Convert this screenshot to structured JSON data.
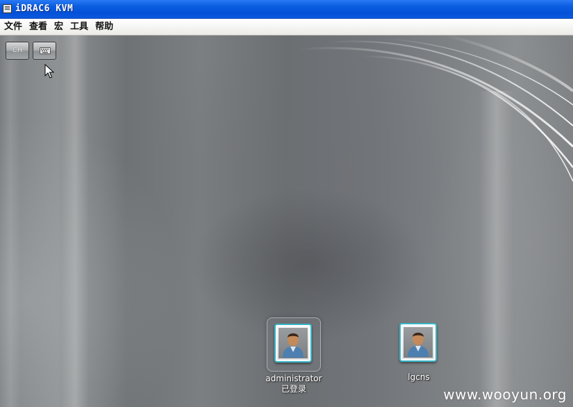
{
  "window": {
    "title": "iDRAC6 KVM",
    "title_icon": "window-app-icon",
    "titlebar_color": "#0b5de0"
  },
  "menu": {
    "items": [
      {
        "label": "文件"
      },
      {
        "label": "查看"
      },
      {
        "label": "宏"
      },
      {
        "label": "工具"
      },
      {
        "label": "帮助"
      }
    ]
  },
  "toolbar": {
    "ch_label": "CH",
    "keyboard_icon": "keyboard-icon"
  },
  "login_screen": {
    "users": [
      {
        "name": "administrator",
        "status": "已登录",
        "selected": true,
        "icon": "user-avatar-icon"
      },
      {
        "name": "lgcns",
        "status": "",
        "selected": false,
        "icon": "user-avatar-icon"
      }
    ],
    "accent_color": "#38b6c8"
  },
  "watermark": "www.wooyun.org"
}
